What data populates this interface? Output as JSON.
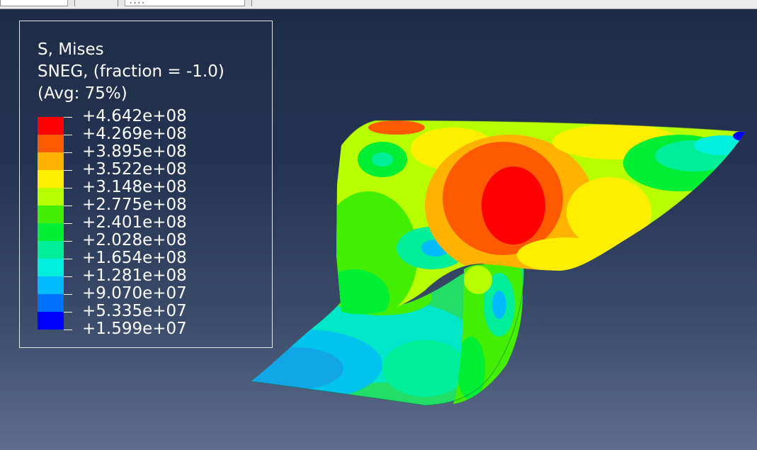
{
  "toolbar": {
    "combo_left_value": "",
    "combo_mid_value": "',  , , ,"
  },
  "legend": {
    "variable": "S, Mises",
    "section_point": "SNEG, (fraction = -1.0)",
    "averaging": "(Avg: 75%)",
    "values": [
      "+4.642e+08",
      "+4.269e+08",
      "+3.895e+08",
      "+3.522e+08",
      "+3.148e+08",
      "+2.775e+08",
      "+2.401e+08",
      "+2.028e+08",
      "+1.654e+08",
      "+1.281e+08",
      "+9.070e+07",
      "+5.335e+07",
      "+1.599e+07"
    ],
    "colors": [
      "#ff0000",
      "#ff5a00",
      "#ffb300",
      "#ffee00",
      "#b8ff00",
      "#44ee00",
      "#00ee33",
      "#00ee99",
      "#00eedd",
      "#00bbff",
      "#0070ff",
      "#0000ff"
    ]
  }
}
